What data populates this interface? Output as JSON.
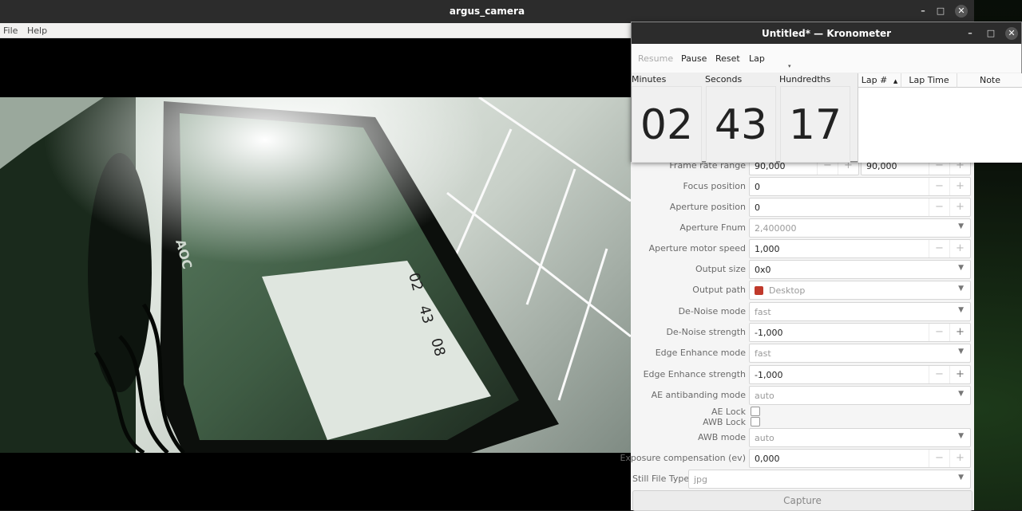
{
  "argus": {
    "title": "argus_camera",
    "menu": [
      "File",
      "Help"
    ],
    "window_buttons": [
      "–",
      "□",
      "✕"
    ]
  },
  "kronometer": {
    "title": "Untitled* — Kronometer",
    "window_buttons": [
      "–",
      "□",
      "✕"
    ],
    "toolbar": {
      "resume": "Resume",
      "pause": "Pause",
      "reset": "Reset",
      "lap": "Lap"
    },
    "labels": {
      "minutes": "Minutes",
      "seconds": "Seconds",
      "hundredths": "Hundredths"
    },
    "time": {
      "minutes": "02",
      "seconds": "43",
      "hundredths": "17"
    },
    "lap_columns": [
      "Lap #",
      "Lap Time",
      "Note"
    ]
  },
  "settings": {
    "frame_rate_range": {
      "label": "Frame rate range",
      "min": "90,000",
      "max": "90,000"
    },
    "focus_position": {
      "label": "Focus position",
      "value": "0"
    },
    "aperture_position": {
      "label": "Aperture position",
      "value": "0"
    },
    "aperture_fnum": {
      "label": "Aperture Fnum",
      "value": "2,400000"
    },
    "aperture_motor_speed": {
      "label": "Aperture motor speed",
      "value": "1,000"
    },
    "output_size": {
      "label": "Output size",
      "value": "0x0"
    },
    "output_path": {
      "label": "Output path",
      "value": "Desktop"
    },
    "denoise_mode": {
      "label": "De-Noise mode",
      "value": "fast"
    },
    "denoise_strength": {
      "label": "De-Noise strength",
      "value": "-1,000"
    },
    "edge_enhance_mode": {
      "label": "Edge Enhance mode",
      "value": "fast"
    },
    "edge_enhance_strength": {
      "label": "Edge Enhance strength",
      "value": "-1,000"
    },
    "ae_antibanding_mode": {
      "label": "AE antibanding mode",
      "value": "auto"
    },
    "ae_lock": {
      "label": "AE Lock",
      "checked": false
    },
    "awb_lock": {
      "label": "AWB Lock",
      "checked": false
    },
    "awb_mode": {
      "label": "AWB mode",
      "value": "auto"
    },
    "exposure_compensation": {
      "label": "Exposure compensation (ev)",
      "value": "0,000"
    },
    "still_file_type": {
      "label": "Still File Type",
      "value": "jpg"
    },
    "capture_label": "Capture"
  },
  "camera_preview": {
    "monitor_brand": "AOC",
    "reflected_digits": [
      "02",
      "43",
      "08"
    ]
  },
  "colors": {
    "titlebar": "#2c2c2c",
    "panel": "#f5f5f5",
    "close_button": "#555555",
    "desktop_path_icon": "#c0392b"
  }
}
